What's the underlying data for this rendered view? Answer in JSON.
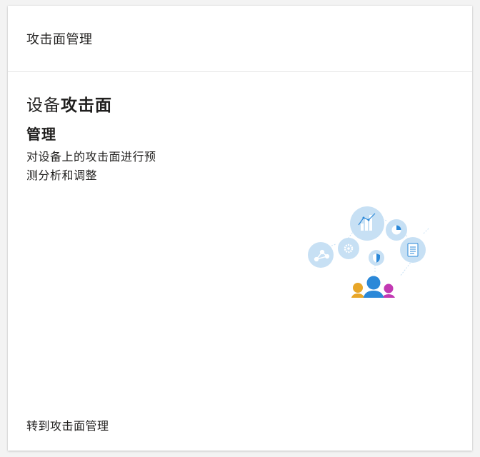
{
  "card": {
    "header_title": "攻击面管理",
    "hero": {
      "title_light": "设备",
      "title_bold": "攻击面",
      "title_line2": "管理",
      "description": "对设备上的攻击面进行预测分析和调整"
    },
    "footer_link": "转到攻击面管理"
  },
  "illustration": {
    "icons": [
      "share-node-icon",
      "gear-icon",
      "bar-chart-icon",
      "pie-chart-icon",
      "document-icon",
      "shield-icon",
      "people-icon"
    ],
    "colors": {
      "bubble": "#c7e0f4",
      "bubble_glyph": "#ffffff",
      "person_center": "#2b88d8",
      "person_left": "#e8a628",
      "person_right": "#c239b3"
    }
  }
}
